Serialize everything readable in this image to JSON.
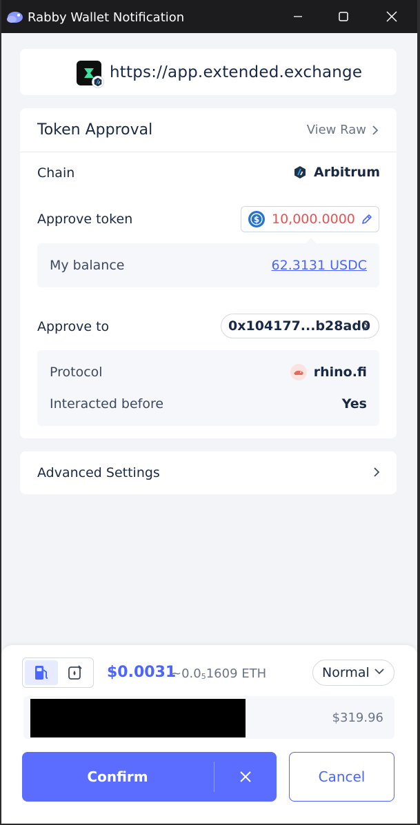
{
  "window": {
    "title": "Rabby Wallet Notification",
    "icons": {
      "app": "rabby-icon",
      "minimize": "minimize-icon",
      "maximize": "maximize-icon",
      "close": "close-icon"
    }
  },
  "site": {
    "url": "https://app.extended.exchange",
    "logo_icon": "extended-logo-icon",
    "chain_badge_icon": "arbitrum-badge-icon"
  },
  "approval": {
    "title": "Token Approval",
    "view_raw": "View Raw",
    "chain_label": "Chain",
    "chain_value": "Arbitrum",
    "approve_token_label": "Approve token",
    "approve_amount": "10,000.0000",
    "my_balance_label": "My balance",
    "my_balance_value": "62.3131 USDC",
    "approve_to_label": "Approve to",
    "approve_to_address": "0x104177...b28ad0",
    "protocol_label": "Protocol",
    "protocol_value": "rhino.fi",
    "interacted_label": "Interacted before",
    "interacted_value": "Yes"
  },
  "advanced": {
    "label": "Advanced Settings"
  },
  "gas": {
    "usd": "$0.0031",
    "eth_prefix": "~0.0",
    "eth_sub": "5",
    "eth_suffix": "1609 ETH",
    "speed": "Normal",
    "balance_usd": "$319.96"
  },
  "actions": {
    "confirm": "Confirm",
    "cancel": "Cancel"
  },
  "colors": {
    "accent": "#4c65ff",
    "confirm_bg": "#5b6dff",
    "danger_amount": "#ec5151",
    "page_bg": "#f2f4f7"
  }
}
